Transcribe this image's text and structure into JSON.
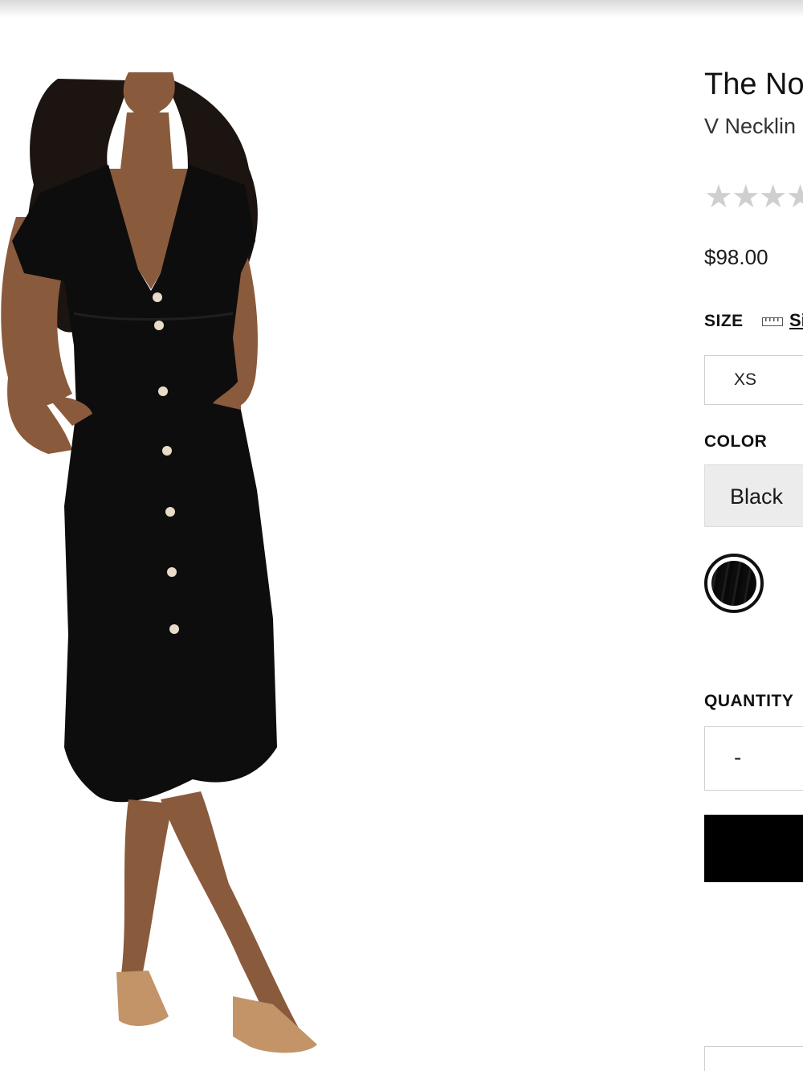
{
  "product": {
    "title": "The No",
    "subtitle": "V Necklin",
    "rating_stars": [
      "★",
      "★",
      "★",
      "★"
    ],
    "price": "$98.00",
    "image_alt": "Model wearing black button-front midi dress"
  },
  "size": {
    "label": "SIZE",
    "guide_link": "Si",
    "guide_icon": "ruler-icon",
    "options": [
      "XS"
    ]
  },
  "color": {
    "label": "COLOR",
    "selected": "Black",
    "swatch_icon": "black-swatch"
  },
  "quantity": {
    "label": "QUANTITY",
    "decrement_symbol": "-"
  },
  "colors": {
    "swatch": "#0d0d0d",
    "button": "#000000",
    "star": "#cfcfcf",
    "selected_bg": "#ececec"
  }
}
